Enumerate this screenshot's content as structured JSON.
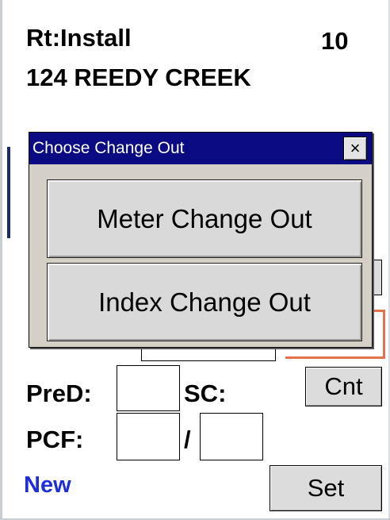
{
  "header": {
    "route": "Rt:Install",
    "route_number": "10",
    "address": "124 REEDY CREEK"
  },
  "form": {
    "pred_label": "PreD:",
    "pred_value": "",
    "sc_label": "SC:",
    "pcf_label": "PCF:",
    "pcf_value_1": "",
    "pcf_separator": "/",
    "pcf_value_2": "",
    "cnt_button": "Cnt",
    "set_button": "Set",
    "new_link": "New"
  },
  "dialog": {
    "title": "Choose Change Out",
    "close_glyph": "×",
    "options": [
      {
        "label": "Meter Change Out"
      },
      {
        "label": "Index Change Out"
      }
    ]
  },
  "colors": {
    "titlebar": "#0a0a82",
    "new_link": "#1e2fd6",
    "highlight_border": "#e5724f",
    "button_face": "#dcdcdc"
  }
}
